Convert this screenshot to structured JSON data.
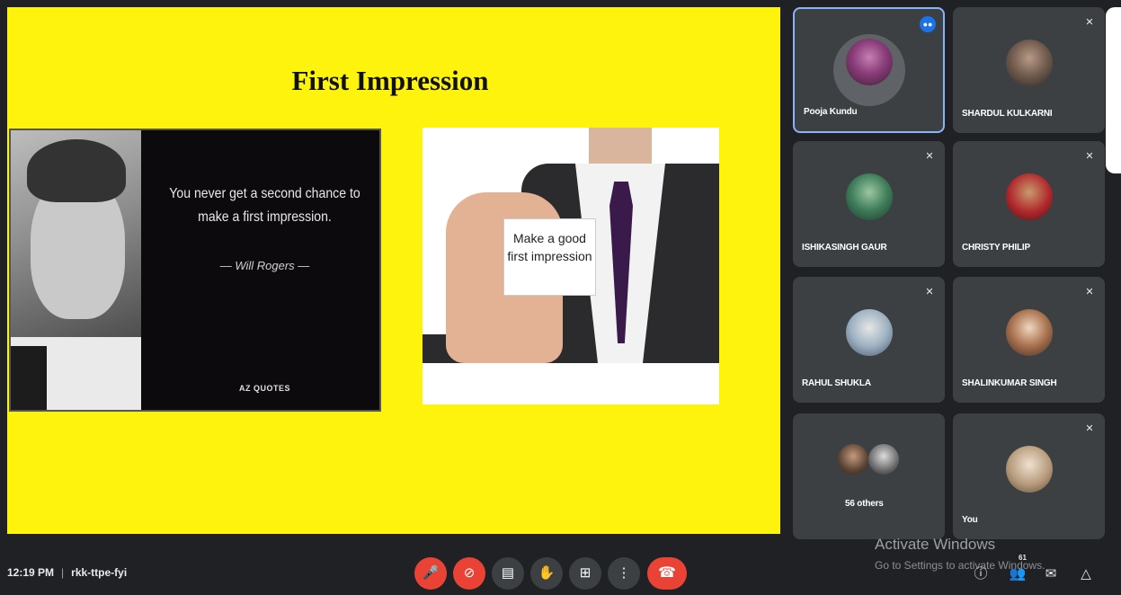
{
  "slide": {
    "title": "First Impression",
    "quote_text": "You never get a second chance to make a first impression.",
    "quote_author": "— Will Rogers —",
    "quote_brand": "AZ QUOTES",
    "card_text": "Make a good first impression"
  },
  "participants": [
    {
      "name": "Pooja Kundu",
      "speaking": true
    },
    {
      "name": "SHARDUL KULKARNI",
      "muted": true
    },
    {
      "name": "ISHIKASINGH GAUR",
      "muted": true
    },
    {
      "name": "CHRISTY PHILIP",
      "muted": true
    },
    {
      "name": "RAHUL SHUKLA",
      "muted": true
    },
    {
      "name": "SHALINKUMAR SINGH",
      "muted": true
    },
    {
      "name": "56 others"
    },
    {
      "name": "You",
      "muted": true
    }
  ],
  "meeting": {
    "time": "12:19 PM",
    "separator": "|",
    "code": "rkk-ttpe-fyi"
  },
  "watermark": {
    "line1": "Activate Windows",
    "line2": "Go to Settings to activate Windows."
  },
  "participant_count": "61",
  "colors": {
    "slide_bg": "#fdf30c",
    "tile_bg": "#3c4043",
    "bar_bg": "#202124",
    "danger": "#ea4335",
    "accent": "#1a73e8"
  }
}
